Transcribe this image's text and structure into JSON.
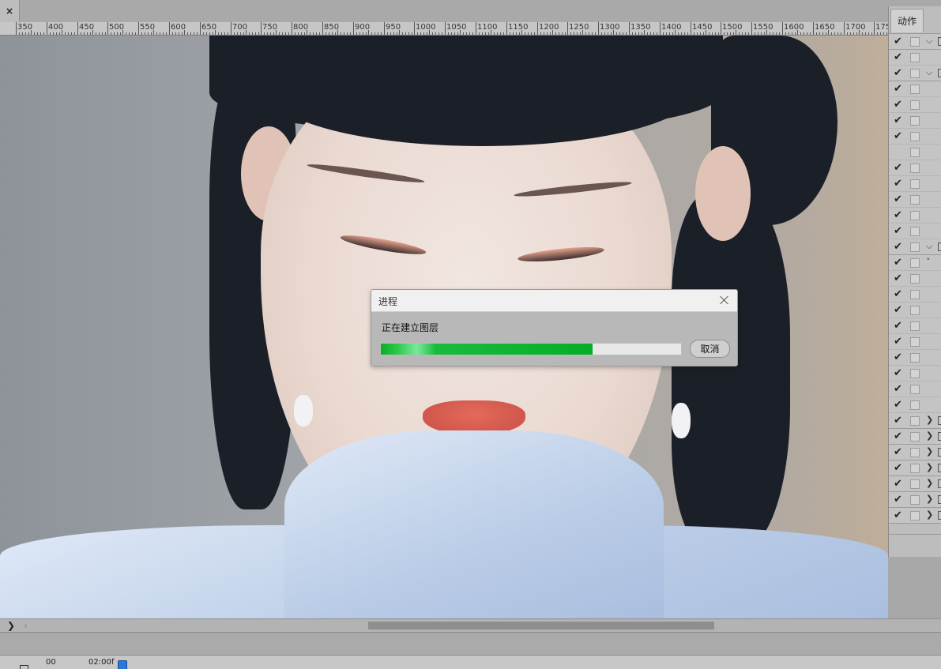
{
  "tabbar": {
    "close_glyph": "×"
  },
  "ruler": {
    "labels": [
      "350",
      "400",
      "450",
      "500",
      "550",
      "600",
      "650",
      "700",
      "750",
      "800",
      "850",
      "900",
      "950",
      "1000",
      "1050",
      "1100",
      "1150",
      "1200",
      "1250",
      "1300",
      "1350",
      "1400",
      "1450",
      "1500",
      "1550",
      "1600",
      "1650",
      "1700",
      "175"
    ]
  },
  "dialog": {
    "title": "进程",
    "message": "正在建立图层",
    "progress_fraction": 0.705,
    "cancel_label": "取消"
  },
  "actions_panel": {
    "tab_label": "动作",
    "rows": [
      {
        "checked": true,
        "arrow": "down",
        "group": true
      },
      {
        "checked": true,
        "arrow": "",
        "group": false
      },
      {
        "checked": true,
        "arrow": "down",
        "group": true
      },
      {
        "checked": true,
        "arrow": "",
        "group": false
      },
      {
        "checked": true,
        "arrow": "",
        "group": false
      },
      {
        "checked": true,
        "arrow": "",
        "group": false
      },
      {
        "checked": true,
        "arrow": "",
        "group": false
      },
      {
        "checked": false,
        "arrow": "",
        "group": false
      },
      {
        "checked": true,
        "arrow": "",
        "group": false
      },
      {
        "checked": true,
        "arrow": "",
        "group": false
      },
      {
        "checked": true,
        "arrow": "",
        "group": false
      },
      {
        "checked": true,
        "arrow": "",
        "group": false
      },
      {
        "checked": true,
        "arrow": "",
        "group": false
      },
      {
        "checked": true,
        "arrow": "down",
        "group": true
      },
      {
        "checked": true,
        "arrow": "small",
        "group": false
      },
      {
        "checked": true,
        "arrow": "",
        "group": false
      },
      {
        "checked": true,
        "arrow": "",
        "group": false
      },
      {
        "checked": true,
        "arrow": "",
        "group": false
      },
      {
        "checked": true,
        "arrow": "",
        "group": false
      },
      {
        "checked": true,
        "arrow": "",
        "group": false
      },
      {
        "checked": true,
        "arrow": "",
        "group": false
      },
      {
        "checked": true,
        "arrow": "",
        "group": false
      },
      {
        "checked": true,
        "arrow": "",
        "group": false
      },
      {
        "checked": true,
        "arrow": "",
        "group": false
      },
      {
        "checked": true,
        "arrow": "right",
        "group": true
      },
      {
        "checked": true,
        "arrow": "right",
        "group": true
      },
      {
        "checked": true,
        "arrow": "right",
        "group": true
      },
      {
        "checked": true,
        "arrow": "right",
        "group": true
      },
      {
        "checked": true,
        "arrow": "right",
        "group": true
      },
      {
        "checked": true,
        "arrow": "right",
        "group": true
      },
      {
        "checked": true,
        "arrow": "right",
        "group": true
      }
    ]
  },
  "timeline": {
    "start_label": "00",
    "time_label": "02:00f"
  },
  "colors": {
    "progress_green": "#06b026",
    "playhead_blue": "#2a78d8"
  }
}
